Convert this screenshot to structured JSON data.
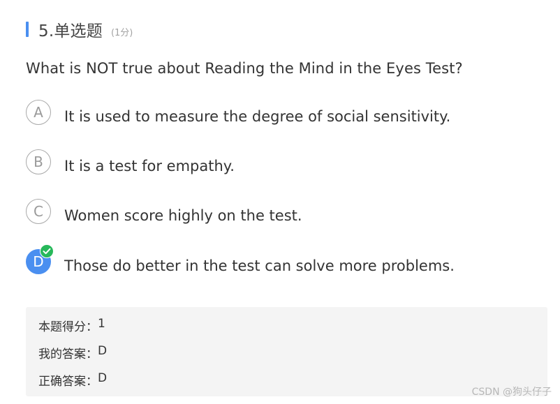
{
  "question": {
    "number_title": "5.单选题",
    "score_label": "(1分)",
    "text": "What is NOT true about Reading the Mind in the Eyes Test?"
  },
  "options": [
    {
      "letter": "A",
      "text": "It is used to measure the degree of social sensitivity.",
      "selected": false
    },
    {
      "letter": "B",
      "text": "It is a test for empathy.",
      "selected": false
    },
    {
      "letter": "C",
      "text": "Women score highly on the test.",
      "selected": false
    },
    {
      "letter": "D",
      "text": "Those do better in the test can solve more problems.",
      "selected": true
    }
  ],
  "result": {
    "score_label": "本题得分：",
    "score_value": "1",
    "my_answer_label": "我的答案：",
    "my_answer_value": "D",
    "correct_answer_label": "正确答案：",
    "correct_answer_value": "D"
  },
  "watermark": "CSDN @狗头仔子",
  "colors": {
    "accent": "#4a8ff0",
    "correct": "#27b85a"
  },
  "icons": {
    "correct_badge": "checkmark-icon"
  }
}
